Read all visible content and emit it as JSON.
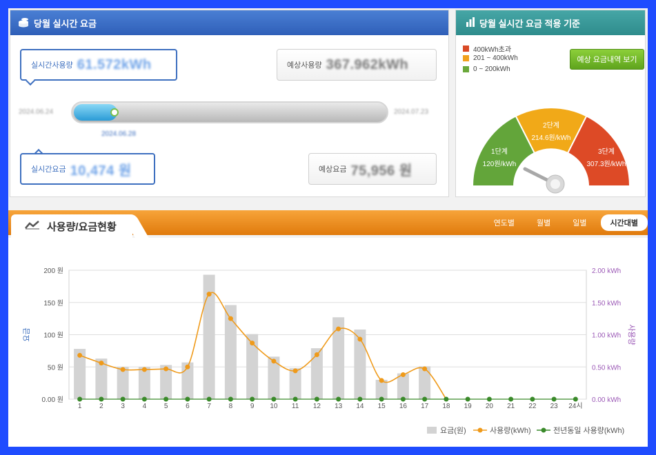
{
  "left_panel": {
    "title": "당월 실시간 요금",
    "realtime_usage_label": "실시간사용량",
    "realtime_usage_value": "61.572kWh",
    "expected_usage_label": "예상사용량",
    "expected_usage_value": "367.962kWh",
    "start_date": "2024.06.24",
    "end_date": "2024.07.23",
    "current_date": "2024.06.28",
    "progress_fraction": 0.14,
    "realtime_fee_label": "실시간요금",
    "realtime_fee_value": "10,474 원",
    "expected_fee_label": "예상요금",
    "expected_fee_value": "75,956 원"
  },
  "right_panel": {
    "title": "당월 실시간 요금 적용 기준",
    "legend": [
      {
        "label": "400kWh초과",
        "color": "#d94a26"
      },
      {
        "label": "201 ~ 400kWh",
        "color": "#f1a11d"
      },
      {
        "label": "0 ~ 200kWh",
        "color": "#6aa83a"
      }
    ],
    "button_label": "예상 요금내역 보기",
    "gauge": [
      {
        "name": "1단계",
        "rate": "120원/kWh",
        "color": "#63a53a"
      },
      {
        "name": "2단계",
        "rate": "214.6원/kWh",
        "color": "#f1a918"
      },
      {
        "name": "3단계",
        "rate": "307.3원/kWh",
        "color": "#dd4a26"
      }
    ]
  },
  "usage_section": {
    "title": "사용량/요금현황",
    "tabs": [
      "연도별",
      "월별",
      "일별",
      "시간대별"
    ],
    "active_tab": "시간대별"
  },
  "chart_data": {
    "type": "bar",
    "categories": [
      "1",
      "2",
      "3",
      "4",
      "5",
      "6",
      "7",
      "8",
      "9",
      "10",
      "11",
      "12",
      "13",
      "14",
      "15",
      "16",
      "17",
      "18",
      "19",
      "20",
      "21",
      "22",
      "23",
      "24시"
    ],
    "ylabel_left": "요금",
    "ylabel_right": "사용량",
    "left_ticks": [
      "200 원",
      "150 원",
      "100 원",
      "50 원",
      "0.00 원"
    ],
    "right_ticks": [
      "2.00 kWh",
      "1.50 kWh",
      "1.00 kWh",
      "0.50 kWh",
      "0.00 kWh"
    ],
    "ylim_left": [
      0,
      200
    ],
    "ylim_right": [
      0,
      2
    ],
    "series": [
      {
        "name": "요금(원)",
        "type": "bar",
        "color": "#d3d3d3",
        "values": [
          78,
          63,
          50,
          50,
          53,
          57,
          193,
          146,
          101,
          66,
          48,
          79,
          127,
          108,
          30,
          40,
          51,
          0,
          0,
          0,
          0,
          0,
          0,
          0
        ]
      },
      {
        "name": "사용량(kWh)",
        "type": "line",
        "color": "#ef9a1a",
        "values": [
          0.68,
          0.56,
          0.46,
          0.46,
          0.47,
          0.5,
          1.63,
          1.25,
          0.87,
          0.59,
          0.44,
          0.69,
          1.09,
          0.93,
          0.29,
          0.38,
          0.47,
          0,
          0,
          0,
          0,
          0,
          0,
          0
        ]
      },
      {
        "name": "전년동일 사용량(kWh)",
        "type": "line",
        "color": "#3a8a2a",
        "values": [
          0,
          0,
          0,
          0,
          0,
          0,
          0,
          0,
          0,
          0,
          0,
          0,
          0,
          0,
          0,
          0,
          0,
          0,
          0,
          0,
          0,
          0,
          0,
          0
        ]
      }
    ],
    "grid": true,
    "legend_position": "bottom-right"
  }
}
